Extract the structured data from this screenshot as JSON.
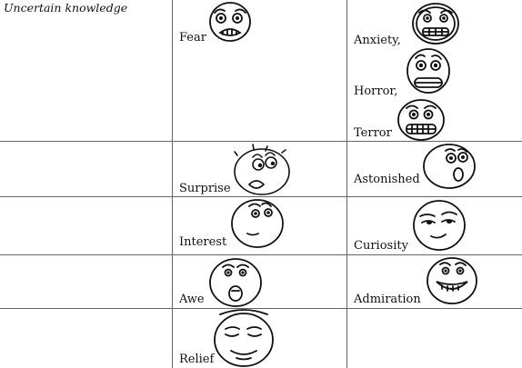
{
  "table": {
    "category": "Uncertain knowledge",
    "rows": [
      {
        "emotion": "Fear",
        "variants": [
          "Anxiety,",
          "Horror,",
          "Terror"
        ]
      },
      {
        "emotion": "Surprise",
        "variants": [
          "Astonished"
        ]
      },
      {
        "emotion": "Interest",
        "variants": [
          "Curiosity"
        ]
      },
      {
        "emotion": "Awe",
        "variants": [
          "Admiration"
        ]
      },
      {
        "emotion": "Relief",
        "variants": []
      }
    ]
  },
  "face_icons": [
    "fear-face-icon",
    "anxiety-face-icon",
    "horror-face-icon",
    "terror-face-icon",
    "surprise-face-icon",
    "astonished-face-icon",
    "interest-face-icon",
    "curiosity-face-icon",
    "awe-face-icon",
    "admiration-face-icon",
    "relief-face-icon"
  ],
  "colors": {
    "ink": "#111111",
    "grid": "#666666",
    "background": "#ffffff"
  }
}
